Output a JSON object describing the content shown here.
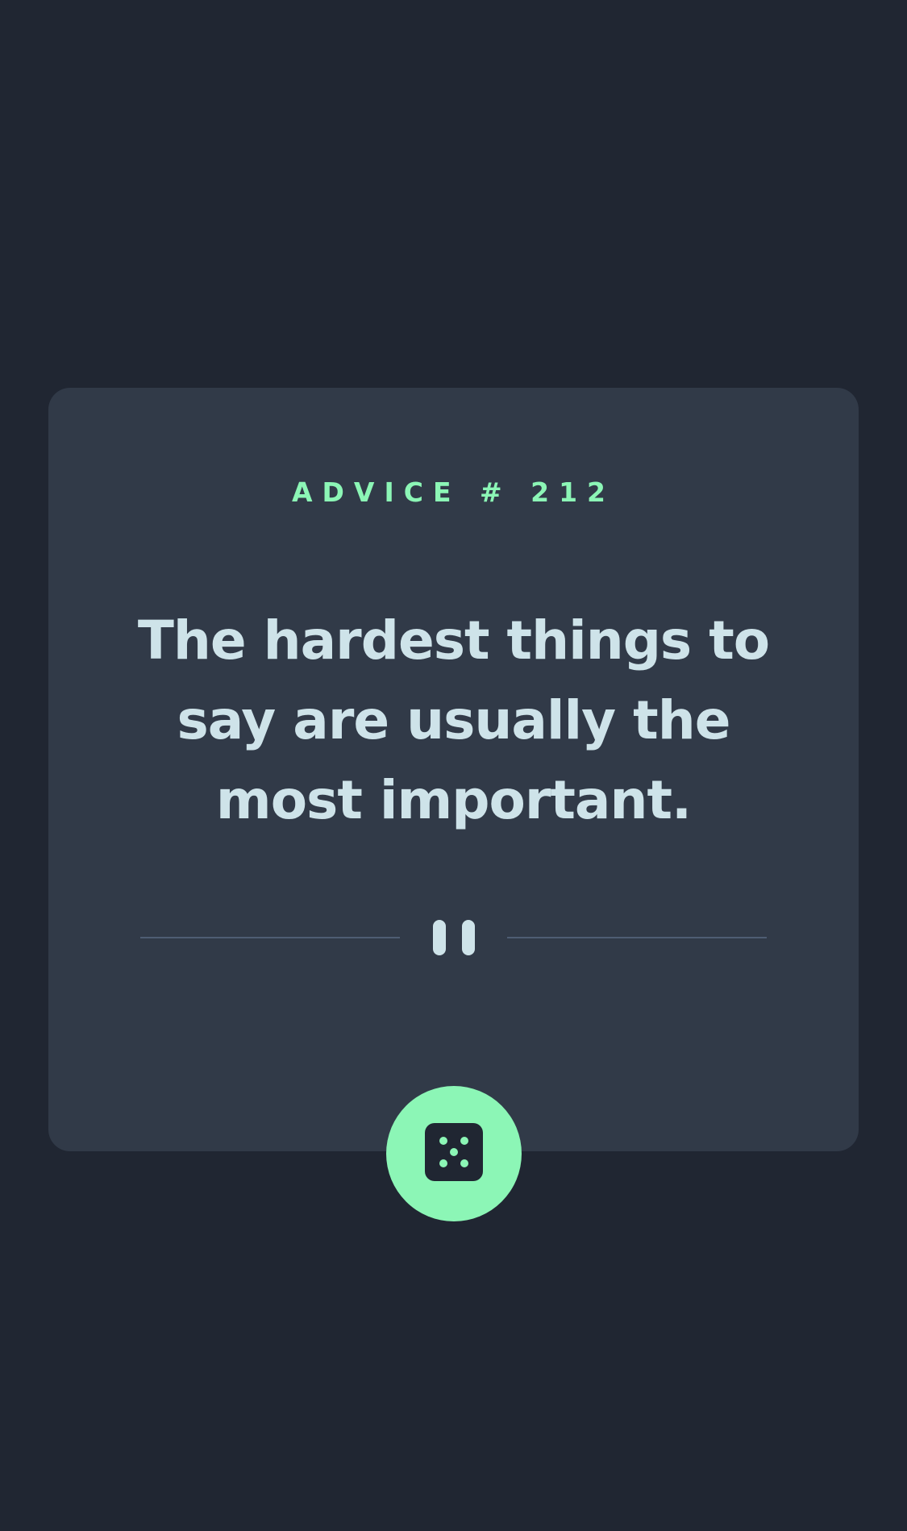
{
  "advice": {
    "label": "ADVICE # 212",
    "quote": "The hardest things to say are usually the most important."
  },
  "icons": {
    "divider": "pause-icon",
    "button": "dice-icon"
  },
  "colors": {
    "background": "#202632",
    "card": "#313a48",
    "accent": "#8cf6b6",
    "text": "#cee3e9",
    "divider_line": "#4e5d73"
  }
}
